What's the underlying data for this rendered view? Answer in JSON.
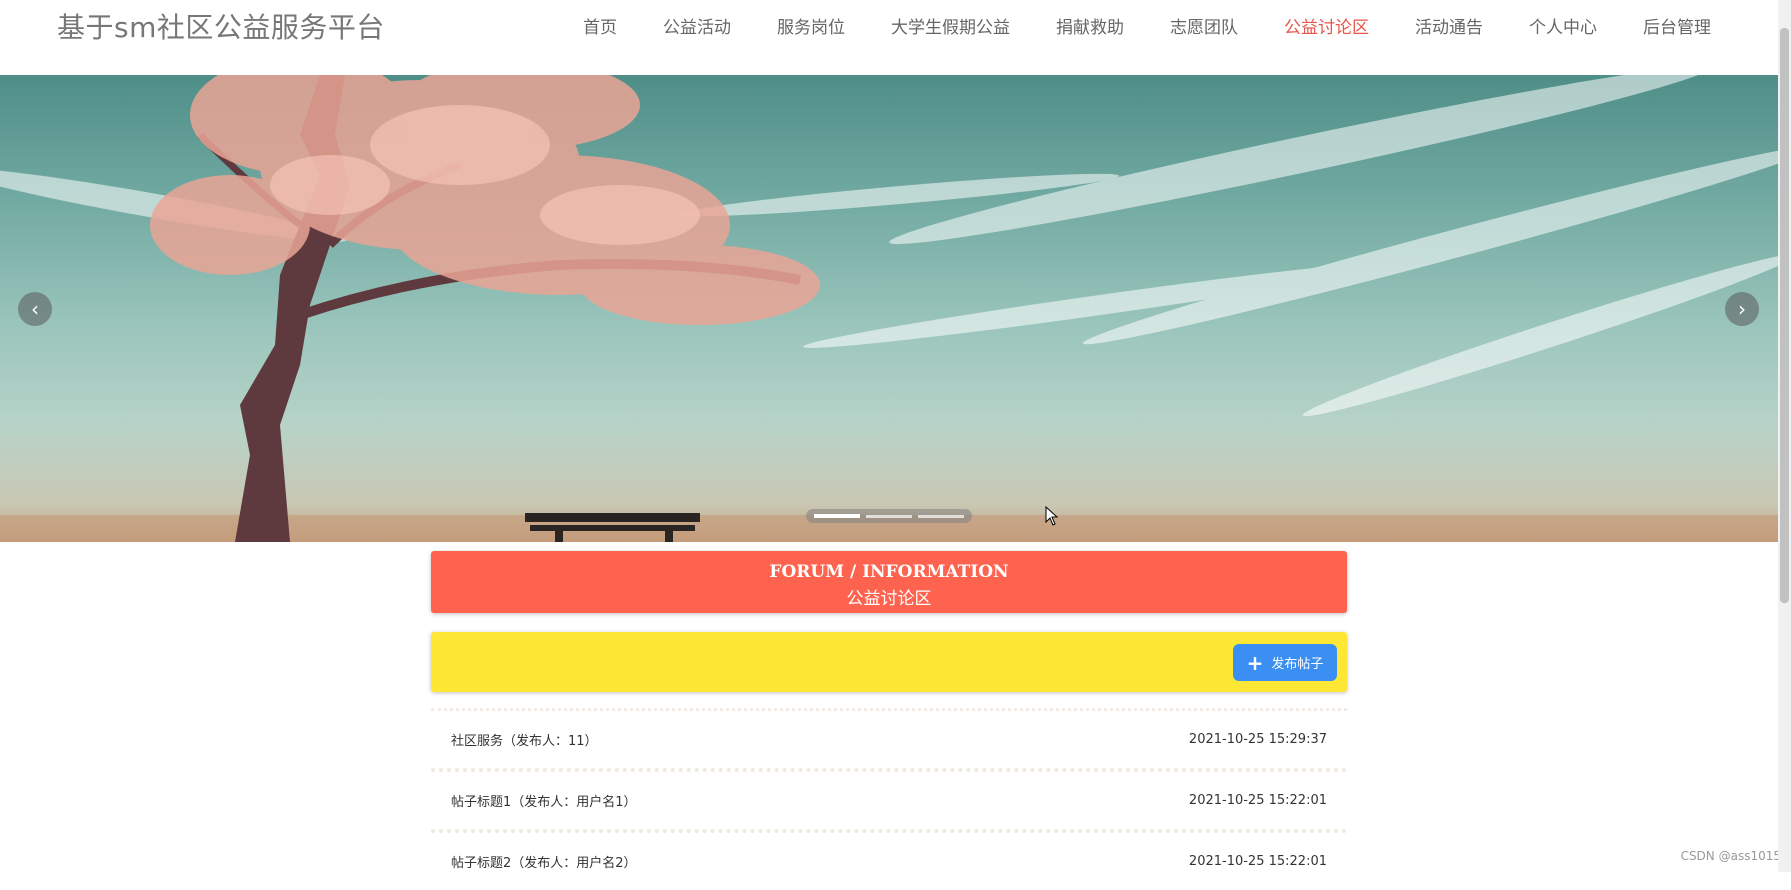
{
  "header": {
    "site_title": "基于sm社区公益服务平台",
    "nav": [
      "首页",
      "公益活动",
      "服务岗位",
      "大学生假期公益",
      "捐献救助",
      "志愿团队",
      "公益讨论区",
      "活动通告",
      "个人中心",
      "后台管理"
    ],
    "active_nav": "公益讨论区"
  },
  "carousel": {
    "prev_icon": "chevron-left-icon",
    "next_icon": "chevron-right-icon",
    "slide_count": 3,
    "active_slide": 1
  },
  "forum": {
    "title_en": "FORUM / INFORMATION",
    "title_cn": "公益讨论区",
    "post_button": "发布帖子",
    "posts": [
      {
        "title": "社区服务（发布人：11）",
        "time": "2021-10-25 15:29:37"
      },
      {
        "title": "帖子标题1（发布人：用户名1）",
        "time": "2021-10-25 15:22:01"
      },
      {
        "title": "帖子标题2（发布人：用户名2）",
        "time": "2021-10-25 15:22:01"
      }
    ]
  },
  "watermark": "CSDN @ass1015",
  "colors": {
    "accent": "#e8544a",
    "forum_banner": "#fe6350",
    "action_bar": "#ffe735",
    "button": "#3b8ff2"
  }
}
